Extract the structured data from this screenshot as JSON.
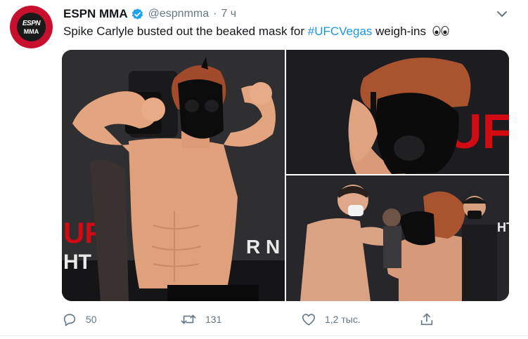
{
  "tweet": {
    "avatar": {
      "line1": "ESPN",
      "line2": "MMA"
    },
    "author_name": "ESPN MMA",
    "handle": "@espnmma",
    "separator": "·",
    "time": "7 ч",
    "text_before": "Spike Carlyle busted out the beaked mask for ",
    "hashtag": "#UFCVegas",
    "text_after": " weigh-ins",
    "emoji": "eyes-emoji",
    "media": {
      "backdrop_text_1": "UFC",
      "backdrop_text_2": "HT N",
      "backdrop_text_3": "R N",
      "backdrop_text_4": "UFC",
      "backdrop_text_5": "HTN"
    }
  },
  "actions": {
    "reply_count": "50",
    "retweet_count": "131",
    "like_count": "1,2 тыс.",
    "icons": [
      "reply-icon",
      "retweet-icon",
      "like-icon",
      "share-icon"
    ]
  },
  "colors": {
    "accent": "#1b95e0",
    "muted": "#657786",
    "ufc_red": "#d20a11"
  }
}
